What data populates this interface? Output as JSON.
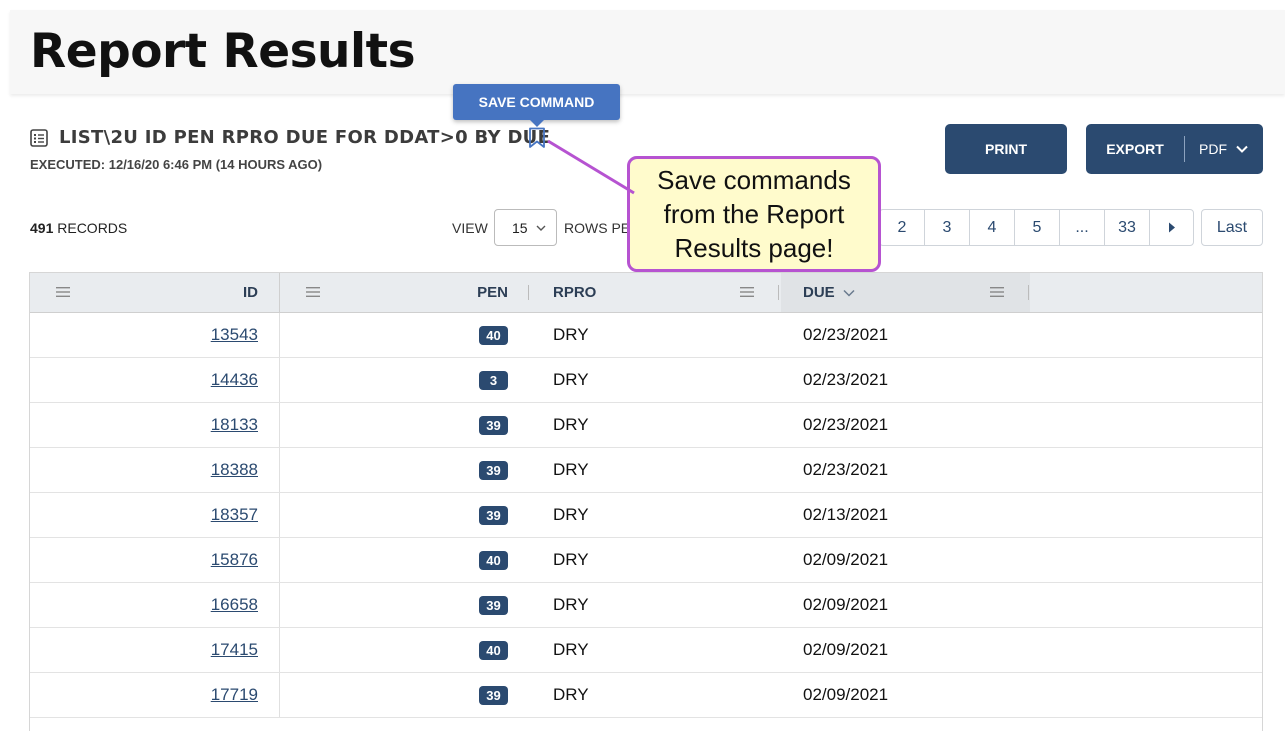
{
  "page": {
    "title": "Report Results"
  },
  "command": {
    "text": "LIST\\2U ID PEN RPRO DUE FOR DDAT>0 BY DUE",
    "executed": "EXECUTED: 12/16/20 6:46 PM (14 HOURS AGO)",
    "save_tooltip": "SAVE COMMAND",
    "icon": "list-icon",
    "bookmark_icon": "bookmark-icon"
  },
  "toolbar": {
    "print_label": "PRINT",
    "export_label": "EXPORT",
    "export_format": "PDF"
  },
  "summary": {
    "records_count": "491",
    "records_label": "RECORDS",
    "view_label": "VIEW",
    "view_value": "15",
    "rows_label": "ROWS PER PAGE"
  },
  "pagination": {
    "pages": [
      "2",
      "3",
      "4",
      "5",
      "...",
      "33"
    ],
    "last_label": "Last"
  },
  "callout": {
    "text": "Save commands from the Report Results page!",
    "border_color": "#b653d1",
    "fill_color": "#fffbcc"
  },
  "table": {
    "columns": [
      "ID",
      "PEN",
      "RPRO",
      "DUE"
    ],
    "rows": [
      {
        "id": "13543",
        "pen": "40",
        "rpro": "DRY",
        "due": "02/23/2021"
      },
      {
        "id": "14436",
        "pen": "3",
        "rpro": "DRY",
        "due": "02/23/2021"
      },
      {
        "id": "18133",
        "pen": "39",
        "rpro": "DRY",
        "due": "02/23/2021"
      },
      {
        "id": "18388",
        "pen": "39",
        "rpro": "DRY",
        "due": "02/23/2021"
      },
      {
        "id": "18357",
        "pen": "39",
        "rpro": "DRY",
        "due": "02/13/2021"
      },
      {
        "id": "15876",
        "pen": "40",
        "rpro": "DRY",
        "due": "02/09/2021"
      },
      {
        "id": "16658",
        "pen": "39",
        "rpro": "DRY",
        "due": "02/09/2021"
      },
      {
        "id": "17415",
        "pen": "40",
        "rpro": "DRY",
        "due": "02/09/2021"
      },
      {
        "id": "17719",
        "pen": "39",
        "rpro": "DRY",
        "due": "02/09/2021"
      }
    ]
  },
  "colors": {
    "primary": "#2b4a70",
    "tooltip": "#4674c1"
  }
}
